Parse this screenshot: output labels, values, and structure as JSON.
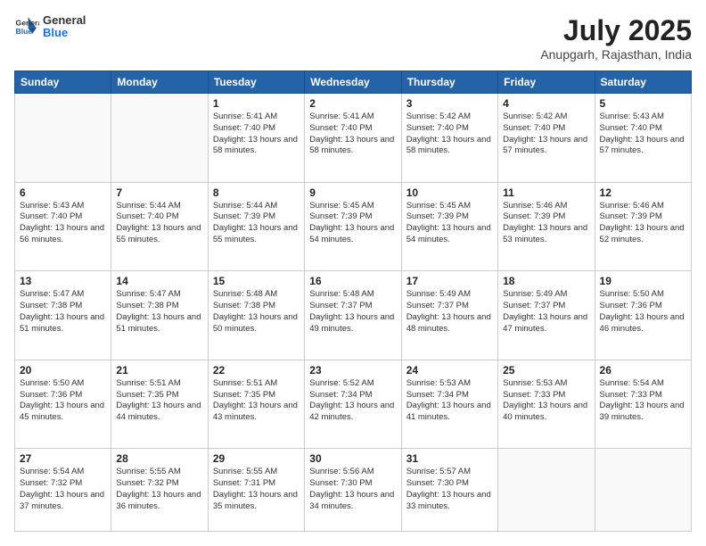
{
  "header": {
    "logo_general": "General",
    "logo_blue": "Blue",
    "month_year": "July 2025",
    "location": "Anupgarh, Rajasthan, India"
  },
  "days_of_week": [
    "Sunday",
    "Monday",
    "Tuesday",
    "Wednesday",
    "Thursday",
    "Friday",
    "Saturday"
  ],
  "weeks": [
    [
      {
        "day": "",
        "info": ""
      },
      {
        "day": "",
        "info": ""
      },
      {
        "day": "1",
        "info": "Sunrise: 5:41 AM\nSunset: 7:40 PM\nDaylight: 13 hours and 58 minutes."
      },
      {
        "day": "2",
        "info": "Sunrise: 5:41 AM\nSunset: 7:40 PM\nDaylight: 13 hours and 58 minutes."
      },
      {
        "day": "3",
        "info": "Sunrise: 5:42 AM\nSunset: 7:40 PM\nDaylight: 13 hours and 58 minutes."
      },
      {
        "day": "4",
        "info": "Sunrise: 5:42 AM\nSunset: 7:40 PM\nDaylight: 13 hours and 57 minutes."
      },
      {
        "day": "5",
        "info": "Sunrise: 5:43 AM\nSunset: 7:40 PM\nDaylight: 13 hours and 57 minutes."
      }
    ],
    [
      {
        "day": "6",
        "info": "Sunrise: 5:43 AM\nSunset: 7:40 PM\nDaylight: 13 hours and 56 minutes."
      },
      {
        "day": "7",
        "info": "Sunrise: 5:44 AM\nSunset: 7:40 PM\nDaylight: 13 hours and 55 minutes."
      },
      {
        "day": "8",
        "info": "Sunrise: 5:44 AM\nSunset: 7:39 PM\nDaylight: 13 hours and 55 minutes."
      },
      {
        "day": "9",
        "info": "Sunrise: 5:45 AM\nSunset: 7:39 PM\nDaylight: 13 hours and 54 minutes."
      },
      {
        "day": "10",
        "info": "Sunrise: 5:45 AM\nSunset: 7:39 PM\nDaylight: 13 hours and 54 minutes."
      },
      {
        "day": "11",
        "info": "Sunrise: 5:46 AM\nSunset: 7:39 PM\nDaylight: 13 hours and 53 minutes."
      },
      {
        "day": "12",
        "info": "Sunrise: 5:46 AM\nSunset: 7:39 PM\nDaylight: 13 hours and 52 minutes."
      }
    ],
    [
      {
        "day": "13",
        "info": "Sunrise: 5:47 AM\nSunset: 7:38 PM\nDaylight: 13 hours and 51 minutes."
      },
      {
        "day": "14",
        "info": "Sunrise: 5:47 AM\nSunset: 7:38 PM\nDaylight: 13 hours and 51 minutes."
      },
      {
        "day": "15",
        "info": "Sunrise: 5:48 AM\nSunset: 7:38 PM\nDaylight: 13 hours and 50 minutes."
      },
      {
        "day": "16",
        "info": "Sunrise: 5:48 AM\nSunset: 7:37 PM\nDaylight: 13 hours and 49 minutes."
      },
      {
        "day": "17",
        "info": "Sunrise: 5:49 AM\nSunset: 7:37 PM\nDaylight: 13 hours and 48 minutes."
      },
      {
        "day": "18",
        "info": "Sunrise: 5:49 AM\nSunset: 7:37 PM\nDaylight: 13 hours and 47 minutes."
      },
      {
        "day": "19",
        "info": "Sunrise: 5:50 AM\nSunset: 7:36 PM\nDaylight: 13 hours and 46 minutes."
      }
    ],
    [
      {
        "day": "20",
        "info": "Sunrise: 5:50 AM\nSunset: 7:36 PM\nDaylight: 13 hours and 45 minutes."
      },
      {
        "day": "21",
        "info": "Sunrise: 5:51 AM\nSunset: 7:35 PM\nDaylight: 13 hours and 44 minutes."
      },
      {
        "day": "22",
        "info": "Sunrise: 5:51 AM\nSunset: 7:35 PM\nDaylight: 13 hours and 43 minutes."
      },
      {
        "day": "23",
        "info": "Sunrise: 5:52 AM\nSunset: 7:34 PM\nDaylight: 13 hours and 42 minutes."
      },
      {
        "day": "24",
        "info": "Sunrise: 5:53 AM\nSunset: 7:34 PM\nDaylight: 13 hours and 41 minutes."
      },
      {
        "day": "25",
        "info": "Sunrise: 5:53 AM\nSunset: 7:33 PM\nDaylight: 13 hours and 40 minutes."
      },
      {
        "day": "26",
        "info": "Sunrise: 5:54 AM\nSunset: 7:33 PM\nDaylight: 13 hours and 39 minutes."
      }
    ],
    [
      {
        "day": "27",
        "info": "Sunrise: 5:54 AM\nSunset: 7:32 PM\nDaylight: 13 hours and 37 minutes."
      },
      {
        "day": "28",
        "info": "Sunrise: 5:55 AM\nSunset: 7:32 PM\nDaylight: 13 hours and 36 minutes."
      },
      {
        "day": "29",
        "info": "Sunrise: 5:55 AM\nSunset: 7:31 PM\nDaylight: 13 hours and 35 minutes."
      },
      {
        "day": "30",
        "info": "Sunrise: 5:56 AM\nSunset: 7:30 PM\nDaylight: 13 hours and 34 minutes."
      },
      {
        "day": "31",
        "info": "Sunrise: 5:57 AM\nSunset: 7:30 PM\nDaylight: 13 hours and 33 minutes."
      },
      {
        "day": "",
        "info": ""
      },
      {
        "day": "",
        "info": ""
      }
    ]
  ]
}
